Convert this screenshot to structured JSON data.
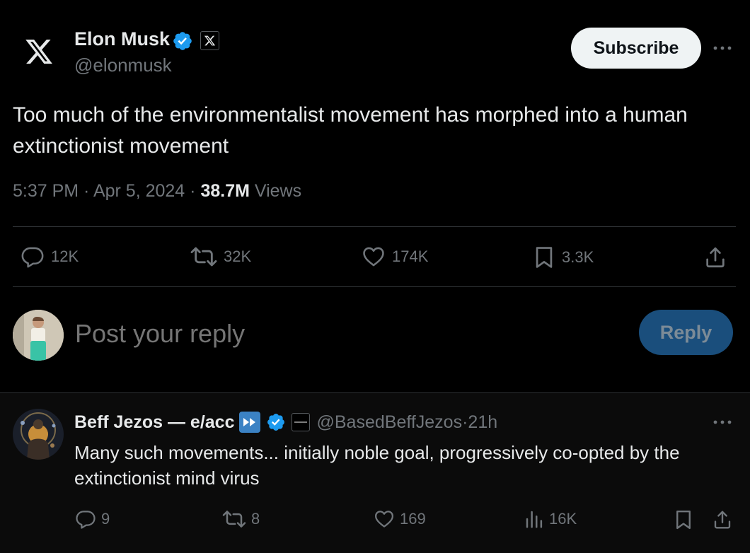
{
  "post": {
    "author_name": "Elon Musk",
    "author_handle": "@elonmusk",
    "subscribe_label": "Subscribe",
    "text": "Too much of the environmentalist movement has morphed into a human extinctionist movement",
    "time": "5:37 PM",
    "date": "Apr 5, 2024",
    "views_count": "38.7M",
    "views_label": "Views",
    "replies": "12K",
    "reposts": "32K",
    "likes": "174K",
    "bookmarks": "3.3K"
  },
  "composer": {
    "placeholder": "Post your reply",
    "reply_label": "Reply"
  },
  "reply": {
    "author_name": "Beff Jezos — e/acc",
    "author_handle": "@BasedBeffJezos",
    "age": "21h",
    "text": "Many such movements... initially noble goal, progressively co-opted by the extinctionist mind virus",
    "replies": "9",
    "reposts": "8",
    "likes": "169",
    "views": "16K"
  },
  "colors": {
    "background": "#000000",
    "text": "#e7e9ea",
    "secondary": "#71767b",
    "verified": "#1d9bf0",
    "reply_button": "#1a4e7c",
    "divider": "#2f3336"
  }
}
